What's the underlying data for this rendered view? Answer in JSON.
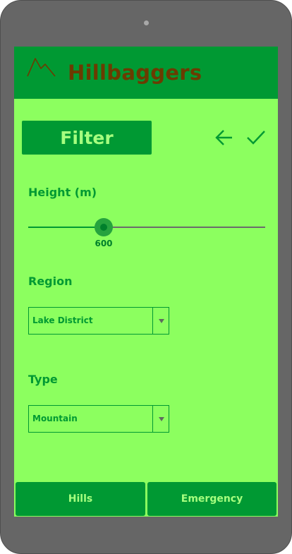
{
  "app": {
    "title": "Hillbaggers",
    "logo_icon": "mountain-icon"
  },
  "colors": {
    "screen_bg": "#8cff5f",
    "primary": "#009933",
    "title_text": "#6b3b00",
    "button_text": "#a6ff7f"
  },
  "toolbar": {
    "filter_label": "Filter",
    "back_icon": "arrow-left-icon",
    "confirm_icon": "checkmark-icon"
  },
  "height": {
    "label": "Height (m)",
    "value": "600",
    "slider_fraction": 0.317
  },
  "region": {
    "label": "Region",
    "selected": "Lake District"
  },
  "type": {
    "label": "Type",
    "selected": "Mountain"
  },
  "bottom_nav": {
    "hills_label": "Hills",
    "emergency_label": "Emergency"
  }
}
